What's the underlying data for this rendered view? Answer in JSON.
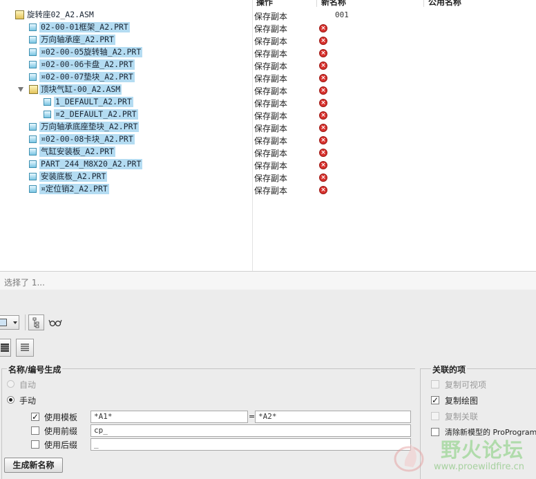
{
  "columns": {
    "operation": "操作",
    "new_name": "新名称",
    "common_name": "公用名称"
  },
  "tree": [
    {
      "name": "旋转座02_A2.ASM",
      "type": "asm",
      "level": 0,
      "selected": false,
      "expand": false,
      "operation": "保存副本",
      "new_name": "001",
      "error": false
    },
    {
      "name": "02-00-01框架_A2.PRT",
      "type": "prt",
      "level": 1,
      "selected": true,
      "operation": "保存副本",
      "new_name": "",
      "error": true
    },
    {
      "name": "万向轴承座_A2.PRT",
      "type": "prt",
      "level": 1,
      "selected": true,
      "operation": "保存副本",
      "new_name": "",
      "error": true
    },
    {
      "name": "¤02-00-05旋转轴_A2.PRT",
      "type": "prt",
      "level": 1,
      "selected": true,
      "operation": "保存副本",
      "new_name": "",
      "error": true
    },
    {
      "name": "¤02-00-06卡盘_A2.PRT",
      "type": "prt",
      "level": 1,
      "selected": true,
      "operation": "保存副本",
      "new_name": "",
      "error": true
    },
    {
      "name": "¤02-00-07垫块_A2.PRT",
      "type": "prt",
      "level": 1,
      "selected": true,
      "operation": "保存副本",
      "new_name": "",
      "error": true
    },
    {
      "name": "顶块气缸-00_A2.ASM",
      "type": "asm",
      "level": 1,
      "selected": true,
      "expand": true,
      "operation": "保存副本",
      "new_name": "",
      "error": true
    },
    {
      "name": "1_DEFAULT_A2.PRT",
      "type": "prt",
      "level": 2,
      "selected": true,
      "operation": "保存副本",
      "new_name": "",
      "error": true
    },
    {
      "name": "¤2_DEFAULT_A2.PRT",
      "type": "prt",
      "level": 2,
      "selected": true,
      "operation": "保存副本",
      "new_name": "",
      "error": true
    },
    {
      "name": "万向轴承底座垫块_A2.PRT",
      "type": "prt",
      "level": 1,
      "selected": true,
      "operation": "保存副本",
      "new_name": "",
      "error": true
    },
    {
      "name": "¤02-00-08卡块_A2.PRT",
      "type": "prt",
      "level": 1,
      "selected": true,
      "operation": "保存副本",
      "new_name": "",
      "error": true
    },
    {
      "name": "气缸安装板_A2.PRT",
      "type": "prt",
      "level": 1,
      "selected": true,
      "operation": "保存副本",
      "new_name": "",
      "error": true
    },
    {
      "name": "PART_244_M8X20_A2.PRT",
      "type": "prt",
      "level": 1,
      "selected": true,
      "operation": "保存副本",
      "new_name": "",
      "error": true
    },
    {
      "name": "安装底板_A2.PRT",
      "type": "prt",
      "level": 1,
      "selected": true,
      "operation": "保存副本",
      "new_name": "",
      "error": true
    },
    {
      "name": "¤定位销2_A2.PRT",
      "type": "prt",
      "level": 1,
      "selected": true,
      "operation": "保存副本",
      "new_name": "",
      "error": true
    }
  ],
  "status": {
    "text": "选择了 1..."
  },
  "naming": {
    "title": "名称/编号生成",
    "auto_label": "自动",
    "manual_label": "手动",
    "mode": "manual",
    "use_template_label": "使用模板",
    "use_template_checked": true,
    "template_from": "*A1*",
    "eq": "=",
    "template_to": "*A2*",
    "use_prefix_label": "使用前缀",
    "use_prefix_checked": false,
    "prefix_value": "cp_",
    "use_suffix_label": "使用后缀",
    "use_suffix_checked": false,
    "suffix_value": "_"
  },
  "generate_label": "生成新名称",
  "related": {
    "title": "关联的项",
    "copy_views": "复制可视项",
    "copy_drawing": "复制绘图",
    "copy_drawing_checked": true,
    "copy_relations": "复制关联",
    "clear_program": "清除新模型的 ProProgram"
  },
  "watermark": {
    "cn": "野火论坛",
    "url": "www.proewildfire.cn"
  },
  "icons": {
    "part": "part-icon",
    "assembly": "assembly-icon",
    "error": "error-x-icon",
    "expand": "collapse-arrow-icon",
    "layout": "layout-icon",
    "tree": "tree-view-icon",
    "glasses": "glasses-icon",
    "list": "list-view-icon",
    "detail": "detail-view-icon"
  },
  "colors": {
    "selection": "#b4dcf2",
    "error": "#d8322e",
    "part_icon": "#7cc6e3",
    "asm_icon": "#e3c35a"
  }
}
